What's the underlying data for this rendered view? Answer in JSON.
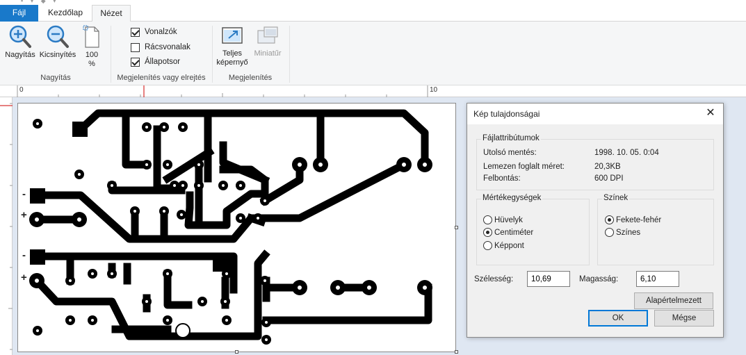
{
  "tabs": {
    "file": "Fájl",
    "home": "Kezdőlap",
    "view": "Nézet"
  },
  "ribbon": {
    "zoom_group": {
      "label": "Nagyítás",
      "zoom_in": "Nagyítás",
      "zoom_out": "Kicsinyítés",
      "hundred_line1": "100",
      "hundred_line2": "%"
    },
    "show_hide_group": {
      "label": "Megjelenítés vagy elrejtés",
      "rulers": {
        "label": "Vonalzók",
        "checked": true
      },
      "gridlines": {
        "label": "Rácsvonalak",
        "checked": false
      },
      "statusbar": {
        "label": "Állapotsor",
        "checked": true
      }
    },
    "display_group": {
      "label": "Megjelenítés",
      "fullscreen_line1": "Teljes",
      "fullscreen_line2": "képernyő",
      "thumbnail": "Miniatűr"
    }
  },
  "ruler": {
    "mark_0": "0",
    "mark_10": "10"
  },
  "dialog": {
    "title": "Kép tulajdonságai",
    "file_attributes": {
      "legend": "Fájlattribútumok",
      "rows": [
        {
          "label": "Utolsó mentés:",
          "value": "1998. 10. 05. 0:04"
        },
        {
          "label": "Lemezen foglalt méret:",
          "value": "20,3KB"
        },
        {
          "label": "Felbontás:",
          "value": "600 DPI"
        }
      ]
    },
    "units": {
      "legend": "Mértékegységek",
      "options": [
        {
          "label": "Hüvelyk",
          "selected": false
        },
        {
          "label": "Centiméter",
          "selected": true
        },
        {
          "label": "Képpont",
          "selected": false
        }
      ]
    },
    "colors": {
      "legend": "Színek",
      "options": [
        {
          "label": "Fekete-fehér",
          "selected": true
        },
        {
          "label": "Színes",
          "selected": false
        }
      ]
    },
    "width_label": "Szélesség:",
    "width_value": "10,69",
    "height_label": "Magasság:",
    "height_value": "6,10",
    "default_button": "Alapértelmezett",
    "ok_button": "OK",
    "cancel_button": "Mégse"
  },
  "canvas": {
    "minus_label_1": "-",
    "plus_label_1": "+",
    "minus_label_2": "-",
    "plus_label_2": "+"
  },
  "colors": {
    "accent": "#1979ca",
    "ribbon_bg": "#f5f6f7",
    "canvas_bg": "#dfe7f2",
    "focus_border": "#0078d7"
  }
}
